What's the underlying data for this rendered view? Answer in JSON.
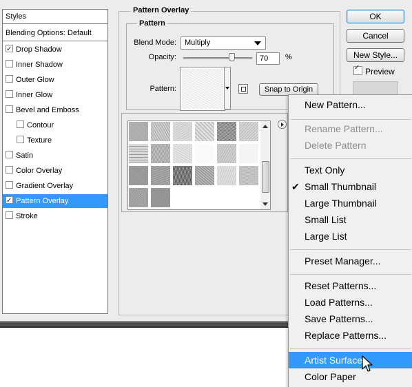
{
  "styles_panel": {
    "header": "Styles",
    "blending": "Blending Options: Default",
    "items": [
      {
        "label": "Drop Shadow",
        "checked": true
      },
      {
        "label": "Inner Shadow",
        "checked": false
      },
      {
        "label": "Outer Glow",
        "checked": false
      },
      {
        "label": "Inner Glow",
        "checked": false
      },
      {
        "label": "Bevel and Emboss",
        "checked": false
      },
      {
        "label": "Contour",
        "checked": false
      },
      {
        "label": "Texture",
        "checked": false
      },
      {
        "label": "Satin",
        "checked": false
      },
      {
        "label": "Color Overlay",
        "checked": false
      },
      {
        "label": "Gradient Overlay",
        "checked": false
      },
      {
        "label": "Pattern Overlay",
        "checked": true,
        "selected": true
      },
      {
        "label": "Stroke",
        "checked": false
      }
    ]
  },
  "pattern_overlay": {
    "title": "Pattern Overlay",
    "group_title": "Pattern",
    "blend_mode_label": "Blend Mode:",
    "blend_mode_value": "Multiply",
    "opacity_label": "Opacity:",
    "opacity_value": "70",
    "opacity_unit": "%",
    "opacity_fraction": 0.7,
    "pattern_label": "Pattern:",
    "snap_button": "Snap to Origin"
  },
  "buttons": {
    "ok": "OK",
    "cancel": "Cancel",
    "new_style": "New Style...",
    "preview": "Preview",
    "preview_checked": true
  },
  "menu": {
    "items": [
      {
        "label": "New Pattern...",
        "state": "enabled"
      },
      {
        "label": "Rename Pattern...",
        "state": "disabled"
      },
      {
        "label": "Delete Pattern",
        "state": "disabled"
      },
      {
        "label": "Text Only",
        "state": "enabled"
      },
      {
        "label": "Small Thumbnail",
        "state": "checked"
      },
      {
        "label": "Large Thumbnail",
        "state": "enabled"
      },
      {
        "label": "Small List",
        "state": "enabled"
      },
      {
        "label": "Large List",
        "state": "enabled"
      },
      {
        "label": "Preset Manager...",
        "state": "enabled"
      },
      {
        "label": "Reset Patterns...",
        "state": "enabled"
      },
      {
        "label": "Load Patterns...",
        "state": "enabled"
      },
      {
        "label": "Save Patterns...",
        "state": "enabled"
      },
      {
        "label": "Replace Patterns...",
        "state": "enabled"
      },
      {
        "label": "Artist Surfaces",
        "state": "highlighted"
      },
      {
        "label": "Color Paper",
        "state": "enabled"
      }
    ]
  },
  "colors": {
    "selection": "#3399ff",
    "dialog_bg": "#ececec",
    "menu_bg": "#f0f0f0"
  },
  "icons": [
    "checkmark-icon",
    "dropdown-arrow-icon",
    "flyout-arrow-icon",
    "new-preset-icon",
    "mouse-pointer-icon"
  ]
}
